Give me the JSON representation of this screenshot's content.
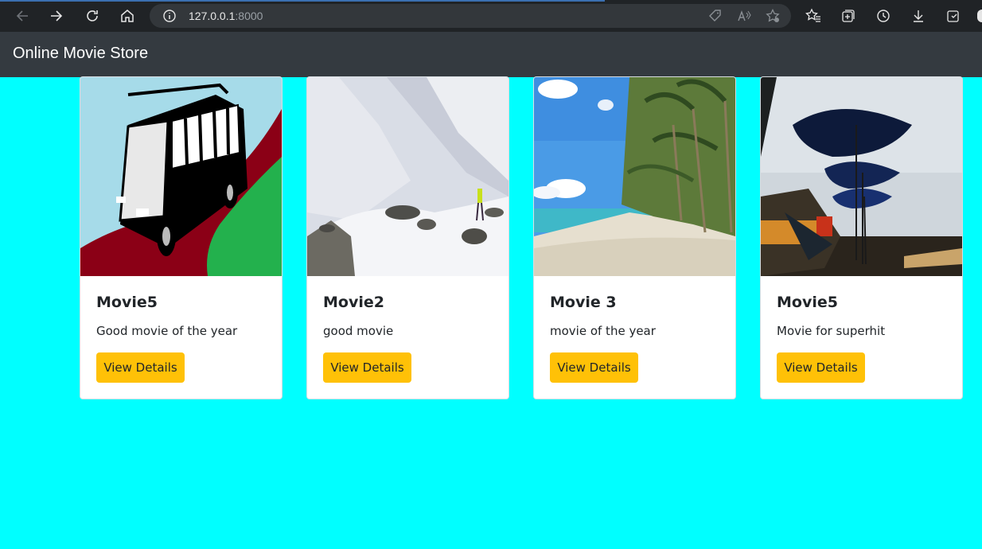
{
  "browser": {
    "url_host": "127.0.0.1",
    "url_port": ":8000"
  },
  "navbar": {
    "brand": "Online Movie Store"
  },
  "colors": {
    "page_background": "#00ffff",
    "navbar": "#343a40",
    "button": "#ffc107"
  },
  "movies": [
    {
      "title": "Movie5",
      "description": "Good movie of the year",
      "button_label": "View Details",
      "image": "bus-illustration"
    },
    {
      "title": "Movie2",
      "description": "good movie",
      "button_label": "View Details",
      "image": "snowy-mountain"
    },
    {
      "title": "Movie 3",
      "description": "movie of the year",
      "button_label": "View Details",
      "image": "palm-beach"
    },
    {
      "title": "Movie5",
      "description": "Movie for superhit",
      "button_label": "View Details",
      "image": "beach-umbrellas"
    }
  ]
}
